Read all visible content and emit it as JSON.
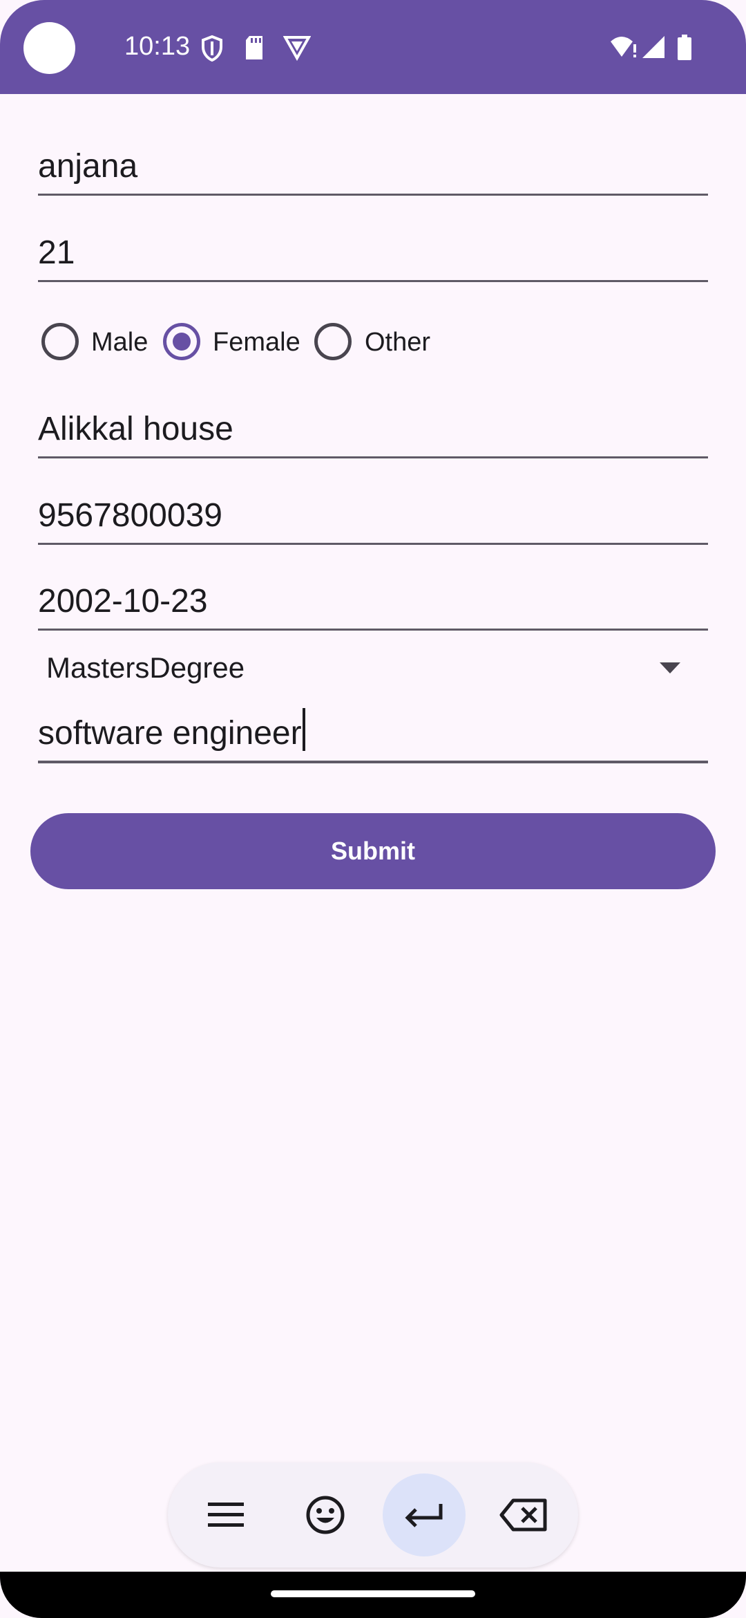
{
  "status_bar": {
    "time": "10:13",
    "bg_color": "#6750a4"
  },
  "form": {
    "name": "anjana",
    "age": "21",
    "gender": {
      "options": [
        "Male",
        "Female",
        "Other"
      ],
      "selected": "Female"
    },
    "address": "Alikkal house",
    "phone": "9567800039",
    "dob": "2002-10-23",
    "qualification": "MastersDegree",
    "occupation": "software engineer",
    "submit_label": "Submit"
  },
  "accent_color": "#6750a4",
  "keyboard_toolbar": {
    "buttons": [
      "menu-icon",
      "emoji-icon",
      "enter-icon",
      "backspace-icon"
    ]
  }
}
